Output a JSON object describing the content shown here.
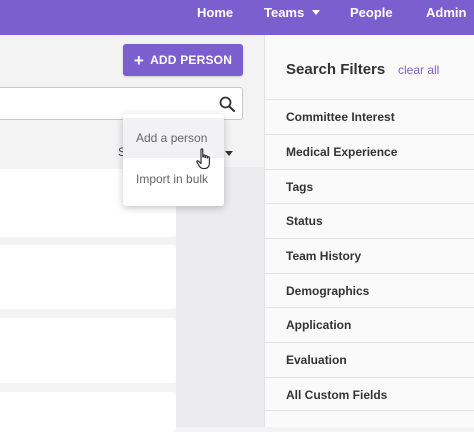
{
  "nav": {
    "home": "Home",
    "teams": "Teams",
    "people": "People",
    "admin": "Admin"
  },
  "toolbar": {
    "add_person_label": "ADD PERSON",
    "sort_label": "S"
  },
  "add_menu": {
    "items": [
      "Add a person",
      "Import in bulk"
    ]
  },
  "filters": {
    "title": "Search Filters",
    "clear_label": "clear all",
    "items": [
      "Committee Interest",
      "Medical Experience",
      "Tags",
      "Status",
      "Team History",
      "Demographics",
      "Application",
      "Evaluation",
      "All Custom Fields"
    ]
  },
  "colors": {
    "accent": "#7b5fcf"
  }
}
